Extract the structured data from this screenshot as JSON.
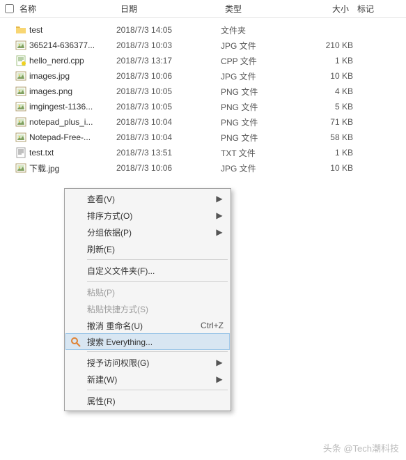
{
  "columns": {
    "name": "名称",
    "date": "日期",
    "type": "类型",
    "size": "大小",
    "tag": "标记"
  },
  "files": [
    {
      "icon": "folder",
      "name": "test",
      "date": "2018/7/3 14:05",
      "type": "文件夹",
      "size": ""
    },
    {
      "icon": "jpg",
      "name": "365214-636377...",
      "date": "2018/7/3 10:03",
      "type": "JPG 文件",
      "size": "210 KB"
    },
    {
      "icon": "cpp",
      "name": "hello_nerd.cpp",
      "date": "2018/7/3 13:17",
      "type": "CPP 文件",
      "size": "1 KB"
    },
    {
      "icon": "jpg",
      "name": "images.jpg",
      "date": "2018/7/3 10:06",
      "type": "JPG 文件",
      "size": "10 KB"
    },
    {
      "icon": "png",
      "name": "images.png",
      "date": "2018/7/3 10:05",
      "type": "PNG 文件",
      "size": "4 KB"
    },
    {
      "icon": "png",
      "name": "imgingest-1136...",
      "date": "2018/7/3 10:05",
      "type": "PNG 文件",
      "size": "5 KB"
    },
    {
      "icon": "png",
      "name": "notepad_plus_i...",
      "date": "2018/7/3 10:04",
      "type": "PNG 文件",
      "size": "71 KB"
    },
    {
      "icon": "png",
      "name": "Notepad-Free-...",
      "date": "2018/7/3 10:04",
      "type": "PNG 文件",
      "size": "58 KB"
    },
    {
      "icon": "txt",
      "name": "test.txt",
      "date": "2018/7/3 13:51",
      "type": "TXT 文件",
      "size": "1 KB"
    },
    {
      "icon": "jpg",
      "name": "下载.jpg",
      "date": "2018/7/3 10:06",
      "type": "JPG 文件",
      "size": "10 KB"
    }
  ],
  "context_menu": [
    {
      "label": "查看(V)",
      "submenu": true
    },
    {
      "label": "排序方式(O)",
      "submenu": true
    },
    {
      "label": "分组依据(P)",
      "submenu": true
    },
    {
      "label": "刷新(E)"
    },
    {
      "separator": true
    },
    {
      "label": "自定义文件夹(F)..."
    },
    {
      "separator": true
    },
    {
      "label": "粘贴(P)",
      "disabled": true
    },
    {
      "label": "粘贴快捷方式(S)",
      "disabled": true
    },
    {
      "label": "撤消 重命名(U)",
      "shortcut": "Ctrl+Z"
    },
    {
      "label": "搜索 Everything...",
      "icon": "search-everything",
      "highlighted": true
    },
    {
      "separator": true
    },
    {
      "label": "授予访问权限(G)",
      "submenu": true
    },
    {
      "label": "新建(W)",
      "submenu": true
    },
    {
      "separator": true
    },
    {
      "label": "属性(R)"
    }
  ],
  "watermark": "头条 @Tech潮科技"
}
